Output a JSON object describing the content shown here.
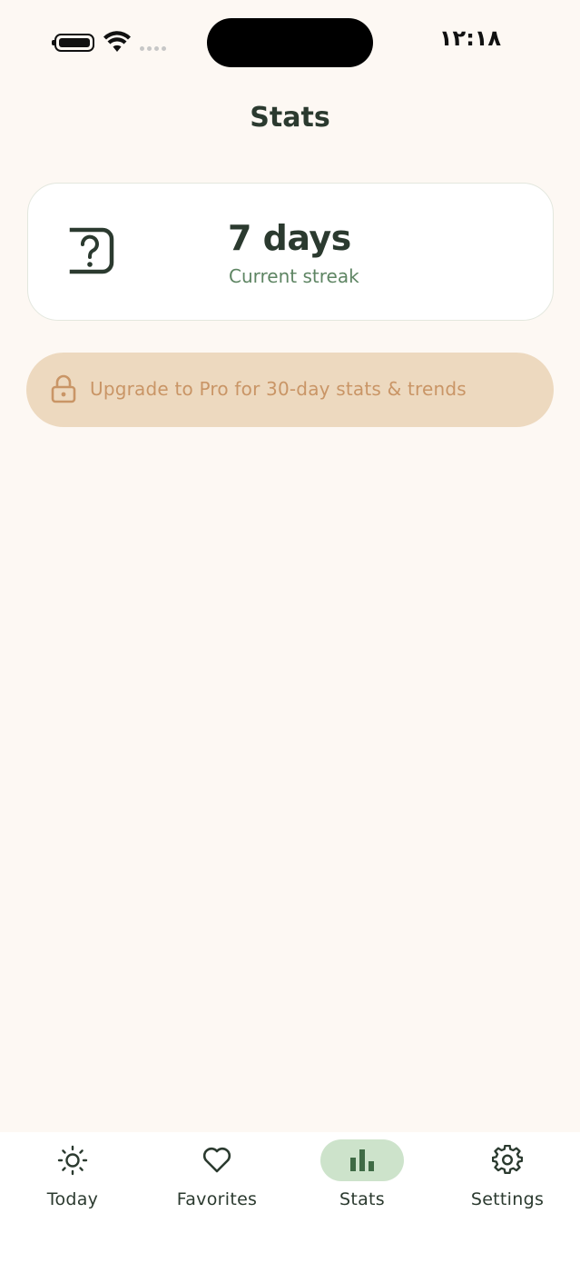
{
  "status_bar": {
    "time": "١٢:١٨"
  },
  "page": {
    "title": "Stats"
  },
  "streak_card": {
    "value": "7 days",
    "label": "Current streak",
    "icon": "question-box-icon"
  },
  "upgrade_banner": {
    "text": "Upgrade to Pro for 30-day stats & trends",
    "icon": "lock-icon"
  },
  "bottom_nav": {
    "items": [
      {
        "label": "Today",
        "icon": "sun-icon"
      },
      {
        "label": "Favorites",
        "icon": "heart-icon"
      },
      {
        "label": "Stats",
        "icon": "bar-chart-icon",
        "active": true
      },
      {
        "label": "Settings",
        "icon": "gear-icon"
      }
    ]
  },
  "colors": {
    "background": "#FDF8F3",
    "text_primary": "#2B3A2F",
    "text_secondary": "#5E8563",
    "banner_bg": "#EDD9BF",
    "banner_text": "#C99566",
    "nav_active_bg": "#CDE3CB"
  }
}
